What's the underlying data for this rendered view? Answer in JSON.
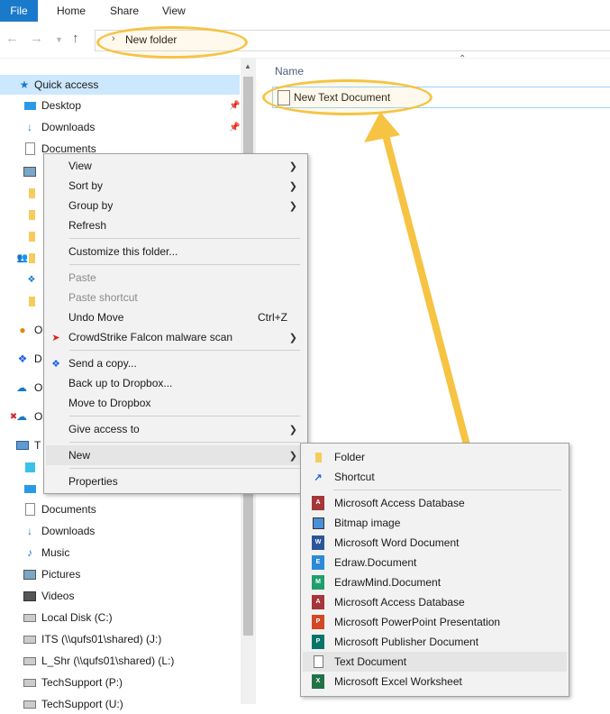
{
  "ribbon": {
    "file": "File",
    "tabs": [
      "Home",
      "Share",
      "View"
    ]
  },
  "address": {
    "path": "New folder"
  },
  "nav": {
    "quick_access": "Quick access",
    "items": [
      {
        "label": "Desktop",
        "icon": "desktop-icon",
        "pinned": true
      },
      {
        "label": "Downloads",
        "icon": "download-icon",
        "pinned": true
      },
      {
        "label": "Documents",
        "icon": "documents-icon",
        "pinned": true
      }
    ],
    "partial": [
      "O",
      "D",
      "O",
      "O",
      "T"
    ],
    "pc_items": [
      "Documents",
      "Downloads",
      "Music",
      "Pictures",
      "Videos",
      "Local Disk (C:)",
      "ITS (\\\\qufs01\\shared) (J:)",
      "L_Shr (\\\\qufs01\\shared) (L:)",
      "TechSupport (P:)",
      "TechSupport (U:)"
    ]
  },
  "content": {
    "column_name": "Name",
    "file_name": "New Text Document"
  },
  "context_menu": {
    "items": [
      {
        "label": "View",
        "submenu": true
      },
      {
        "label": "Sort by",
        "submenu": true
      },
      {
        "label": "Group by",
        "submenu": true
      },
      {
        "label": "Refresh"
      },
      {
        "label": "Customize this folder..."
      },
      {
        "label": "Paste",
        "disabled": true
      },
      {
        "label": "Paste shortcut",
        "disabled": true
      },
      {
        "label": "Undo Move",
        "shortcut": "Ctrl+Z"
      },
      {
        "label": "CrowdStrike Falcon malware scan",
        "submenu": true,
        "icon": "crowdstrike-icon"
      },
      {
        "label": "Send a copy...",
        "icon": "dropbox-icon"
      },
      {
        "label": "Back up to Dropbox..."
      },
      {
        "label": "Move to Dropbox"
      },
      {
        "label": "Give access to",
        "submenu": true
      },
      {
        "label": "New",
        "submenu": true,
        "highlighted": true
      },
      {
        "label": "Properties"
      }
    ]
  },
  "new_submenu": {
    "items": [
      {
        "label": "Folder",
        "icon": "folder-icon"
      },
      {
        "label": "Shortcut",
        "icon": "shortcut-icon"
      },
      {
        "label": "Microsoft Access Database",
        "icon": "access-icon"
      },
      {
        "label": "Bitmap image",
        "icon": "bitmap-icon"
      },
      {
        "label": "Microsoft Word Document",
        "icon": "word-icon"
      },
      {
        "label": "Edraw.Document",
        "icon": "edraw-icon"
      },
      {
        "label": "EdrawMind.Document",
        "icon": "edrawmind-icon"
      },
      {
        "label": "Microsoft Access Database",
        "icon": "access-icon"
      },
      {
        "label": "Microsoft PowerPoint Presentation",
        "icon": "powerpoint-icon"
      },
      {
        "label": "Microsoft Publisher Document",
        "icon": "publisher-icon"
      },
      {
        "label": "Text Document",
        "icon": "text-document-icon",
        "highlighted": true
      },
      {
        "label": "Microsoft Excel Worksheet",
        "icon": "excel-icon"
      }
    ]
  },
  "colors": {
    "accent": "#1979ca",
    "highlight": "#f6c343",
    "selection": "#cce8ff"
  }
}
